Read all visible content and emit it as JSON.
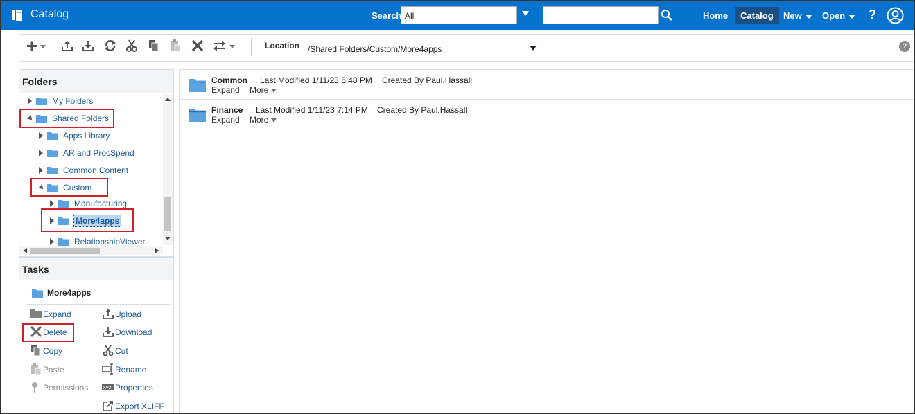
{
  "header": {
    "app_title": "Catalog",
    "search_label": "Search",
    "search_scope": "All",
    "search_placeholder": "",
    "nav": {
      "home": "Home",
      "catalog": "Catalog",
      "new": "New",
      "open": "Open"
    },
    "help": "?"
  },
  "toolbar": {
    "icons": [
      "new-icon",
      "upload-icon",
      "download-icon",
      "refresh-icon",
      "cut-icon",
      "copy-icon",
      "paste-icon",
      "delete-icon",
      "move-icon"
    ],
    "location_label": "Location",
    "location_value": "/Shared Folders/Custom/More4apps",
    "help": "?"
  },
  "folders": {
    "title": "Folders",
    "items": [
      {
        "label": "My Folders"
      },
      {
        "label": "Shared Folders"
      },
      {
        "label": "Apps Library"
      },
      {
        "label": "AR and ProcSpend"
      },
      {
        "label": "Common Content"
      },
      {
        "label": "Custom"
      },
      {
        "label": "Manufacturing"
      },
      {
        "label": "More4apps"
      },
      {
        "label": "RelationshipViewer"
      }
    ]
  },
  "tasks": {
    "title": "Tasks",
    "target": "More4apps",
    "left": [
      {
        "label": "Expand",
        "icon": "expand-folder-icon",
        "enabled": true
      },
      {
        "label": "Delete",
        "icon": "delete-icon",
        "enabled": true
      },
      {
        "label": "Copy",
        "icon": "copy-icon",
        "enabled": true
      },
      {
        "label": "Paste",
        "icon": "paste-icon",
        "enabled": false
      },
      {
        "label": "Permissions",
        "icon": "permissions-icon",
        "enabled": false
      }
    ],
    "right": [
      {
        "label": "Upload",
        "icon": "upload-icon",
        "enabled": true
      },
      {
        "label": "Download",
        "icon": "download-icon",
        "enabled": true
      },
      {
        "label": "Cut",
        "icon": "cut-icon",
        "enabled": true
      },
      {
        "label": "Rename",
        "icon": "rename-icon",
        "enabled": true
      },
      {
        "label": "Properties",
        "icon": "properties-icon",
        "enabled": true
      },
      {
        "label": "Export XLIFF",
        "icon": "export-icon",
        "enabled": true
      }
    ]
  },
  "content": {
    "items": [
      {
        "name": "Common",
        "modified": "Last Modified 1/11/23 6:48 PM",
        "created": "Created By Paul.Hassall",
        "expand": "Expand",
        "more": "More"
      },
      {
        "name": "Finance",
        "modified": "Last Modified 1/11/23 7:14 PM",
        "created": "Created By Paul.Hassall",
        "expand": "Expand",
        "more": "More"
      }
    ]
  },
  "colors": {
    "header_bg": "#0572ce",
    "catalog_active": "#1b4e82",
    "link": "#1f5b99",
    "folder": "#5aa3e0",
    "highlight_box": "#d0202a"
  }
}
